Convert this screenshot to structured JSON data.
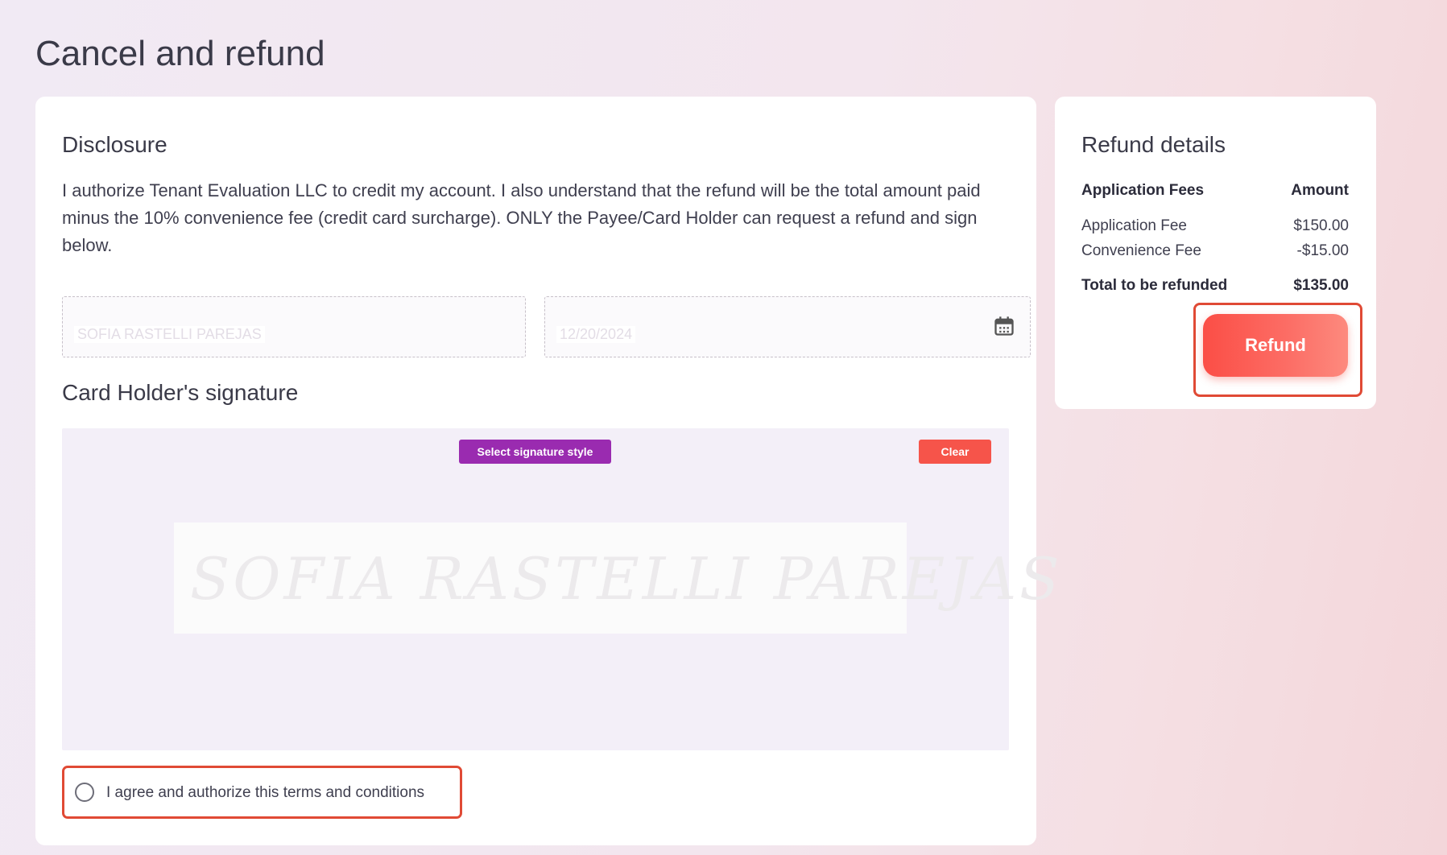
{
  "page": {
    "title": "Cancel and refund"
  },
  "disclosure": {
    "title": "Disclosure",
    "text": "I authorize Tenant Evaluation LLC to credit my account. I also understand that the refund will be the total amount paid minus the 10% convenience fee (credit card surcharge). ONLY the Payee/Card Holder can request a refund and sign below."
  },
  "form": {
    "name_value": "SOFIA RASTELLI PAREJAS",
    "date_value": "12/20/2024",
    "calendar_icon": "calendar-icon"
  },
  "signature": {
    "title": "Card Holder's signature",
    "select_style_label": "Select signature style",
    "clear_label": "Clear",
    "signature_text": "SOFIA RASTELLI PAREJAS"
  },
  "agreement": {
    "label": "I agree and authorize this terms and conditions",
    "checked": false
  },
  "refund_details": {
    "title": "Refund details",
    "header": {
      "label": "Application Fees",
      "amount": "Amount"
    },
    "items": [
      {
        "label": "Application Fee",
        "amount": "$150.00"
      },
      {
        "label": "Convenience Fee",
        "amount": "-$15.00"
      }
    ],
    "total": {
      "label": "Total to be refunded",
      "amount": "$135.00"
    },
    "button_label": "Refund"
  },
  "colors": {
    "accent_red": "#f6544a",
    "signature_purple": "#9a2bb0",
    "highlight_border": "#e04a35"
  }
}
